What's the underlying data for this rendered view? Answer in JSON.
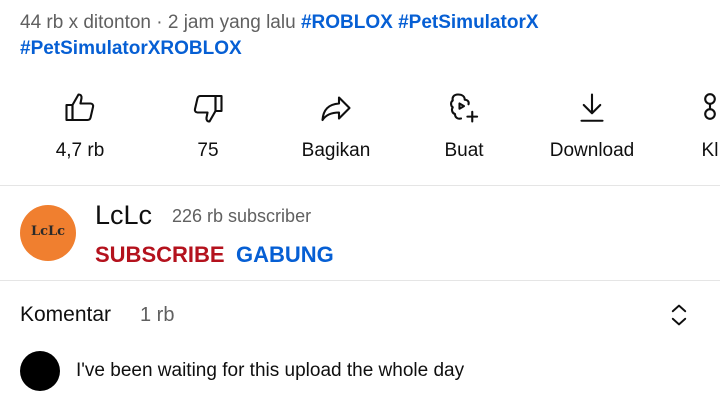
{
  "video": {
    "views": "44 rb x ditonton · 2 jam yang lalu",
    "hashtags": [
      "#ROBLOX",
      "#PetSimulatorX",
      "#PetSimulatorXROBLOX"
    ]
  },
  "actions": {
    "like": {
      "label": "4,7 rb",
      "icon": "thumbs-up-icon"
    },
    "dislike": {
      "label": "75",
      "icon": "thumbs-down-icon"
    },
    "share": {
      "label": "Bagikan",
      "icon": "share-arrow-icon"
    },
    "create": {
      "label": "Buat",
      "icon": "create-sparkle-icon"
    },
    "download": {
      "label": "Download",
      "icon": "download-icon"
    },
    "clip": {
      "label": "Kl",
      "icon": "scissors-icon"
    }
  },
  "channel": {
    "name": "LcLc",
    "avatar_text": "LcLc",
    "avatar_color": "#f07f2f",
    "subscribers": "226 rb subscriber",
    "subscribe_label": "SUBSCRIBE",
    "join_label": "GABUNG",
    "subscribe_color": "#b4121d",
    "join_color": "#065fd4"
  },
  "comments": {
    "title": "Komentar",
    "count": "1 rb",
    "first_comment": "I've been waiting for this upload the whole day"
  }
}
